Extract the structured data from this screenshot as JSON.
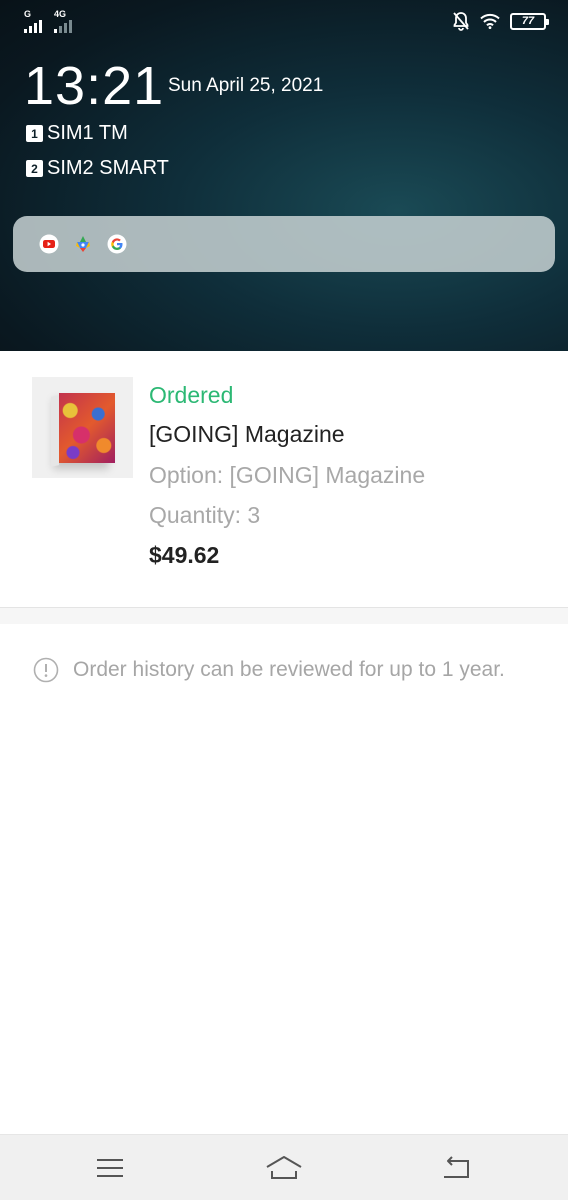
{
  "status_bar": {
    "sim1_network": "G",
    "sim2_network": "4G",
    "battery_level": "77",
    "icons": [
      "notifications-off-icon",
      "wifi-icon",
      "battery-icon"
    ]
  },
  "shade": {
    "time": "13:21",
    "date": "Sun April 25, 2021",
    "sims": [
      {
        "slot": "1",
        "carrier": "SIM1 TM"
      },
      {
        "slot": "2",
        "carrier": "SIM2 SMART"
      }
    ],
    "search_apps": [
      "youtube-icon",
      "play-games-icon",
      "google-icon"
    ]
  },
  "order": {
    "status": "Ordered",
    "title": "[GOING] Magazine",
    "option": "Option: [GOING] Magazine",
    "quantity": "Quantity: 3",
    "price": "$49.62",
    "status_color": "#2cb874"
  },
  "notice": {
    "text": "Order history can be reviewed for up to 1 year.",
    "icon": "info-icon"
  },
  "navbar": {
    "buttons": [
      "menu-icon",
      "home-icon",
      "back-icon"
    ]
  }
}
